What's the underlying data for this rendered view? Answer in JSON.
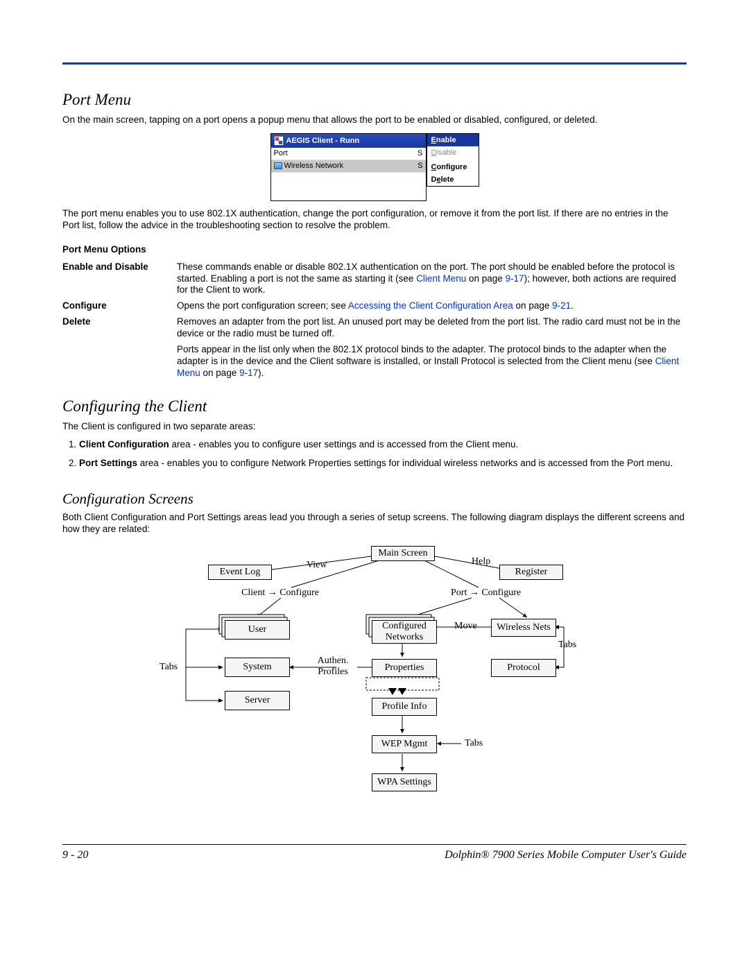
{
  "headings": {
    "port_menu": "Port Menu",
    "configuring": "Configuring the Client",
    "config_screens": "Configuration Screens"
  },
  "paras": {
    "p1": "On the main screen, tapping on a port opens a popup menu that allows the port to be enabled or disabled, configured, or deleted.",
    "p2": "The port menu enables you to use 802.1X authentication, change the port configuration, or remove it from the port list. If there are no entries in the Port list, follow the advice in the troubleshooting section to resolve the problem.",
    "p3": "The Client is configured in two separate areas:",
    "p4": "Both Client Configuration and Port Settings areas lead you through a series of setup screens. The following diagram displays the different screens and how they are related:"
  },
  "screenshot": {
    "title": "AEGIS Client - Runn",
    "row_port": "Port",
    "row_port_s": "S",
    "row_net": "Wireless Network",
    "row_net_s": "S",
    "menu_enable": "Enable",
    "menu_disable": "Disable",
    "menu_configure": "Configure",
    "menu_delete": "Delete"
  },
  "opts": {
    "head": "Port Menu Options",
    "r1_term": "Enable and Disable",
    "r1_a": "These commands enable or disable 802.1X authentication on the port. The port should be enabled before the protocol is started. Enabling a port is not the same as starting it (see ",
    "r1_link1": "Client Menu",
    "r1_b": " on page ",
    "r1_link2": "9-17",
    "r1_c": "); however, both actions are required for the Client to work.",
    "r2_term": "Configure",
    "r2_a": "Opens the port configuration screen; see ",
    "r2_link1": "Accessing the Client Configuration Area",
    "r2_b": " on page ",
    "r2_link2": "9-21",
    "r2_c": ".",
    "r3_term": "Delete",
    "r3_a": "Removes an adapter from the port list. An unused port may be deleted from the port list. The radio card must not be in the device or the radio must be turned off.",
    "r3_b": "Ports appear in the list only when the 802.1X protocol binds to the adapter. The protocol binds to the adapter when the adapter is in the device and the Client software is installed, or Install Protocol is selected from the Client menu (see ",
    "r3_link1": "Client Menu",
    "r3_c": " on page ",
    "r3_link2": "9-17",
    "r3_d": ")."
  },
  "list": {
    "i1_b": "Client Configuration",
    "i1_a": " area - enables you to configure user settings and is accessed from the Client menu.",
    "i2_b": "Port Settings",
    "i2_a": " area - enables you to configure Network Properties settings for individual wireless networks and is accessed from the Port menu."
  },
  "diagram": {
    "main": "Main Screen",
    "eventlog": "Event Log",
    "register": "Register",
    "user": "User",
    "system": "System",
    "server": "Server",
    "confnet": "Configured Networks",
    "properties": "Properties",
    "profileinfo": "Profile Info",
    "wep": "WEP Mgmt",
    "wpa": "WPA Settings",
    "wirelessnets": "Wireless Nets",
    "protocol": "Protocol",
    "view": "View",
    "help": "Help",
    "client_conf": "Client → Configure",
    "port_conf": "Port → Configure",
    "authen": "Authen.\nProfiles",
    "move": "Move",
    "tabs_l": "Tabs",
    "tabs_r1": "Tabs",
    "tabs_r2": "Tabs"
  },
  "footer": {
    "page": "9 - 20",
    "title": "Dolphin® 7900 Series Mobile Computer User's Guide"
  }
}
